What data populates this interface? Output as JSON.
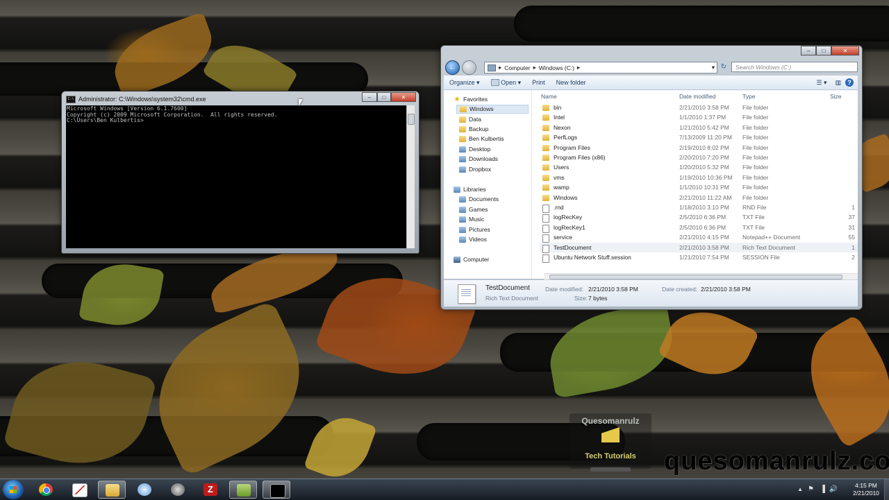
{
  "cmd": {
    "title": "Administrator: C:\\Windows\\system32\\cmd.exe",
    "icon_text": "C:\\",
    "lines": [
      "Microsoft Windows [Version 6.1.7600]",
      "Copyright (c) 2009 Microsoft Corporation.  All rights reserved.",
      "",
      "C:\\Users\\Ben Kulbertis>"
    ]
  },
  "explorer": {
    "breadcrumb": [
      "Computer",
      "Windows (C:)"
    ],
    "search_placeholder": "Search Windows (C:)",
    "toolbar": [
      "Organize",
      "Open",
      "Print",
      "New folder"
    ],
    "nav": {
      "favorites_label": "Favorites",
      "favorites": [
        "Windows",
        "Data",
        "Backup",
        "Ben Kulbertis",
        "Desktop",
        "Downloads",
        "Dropbox"
      ],
      "libraries_label": "Libraries",
      "libraries": [
        "Documents",
        "Games",
        "Music",
        "Pictures",
        "Videos"
      ],
      "computer_label": "Computer"
    },
    "columns": [
      "Name",
      "Date modified",
      "Type",
      "Size"
    ],
    "files": [
      {
        "name": "bin",
        "date": "2/21/2010 3:58 PM",
        "type": "File folder",
        "size": "",
        "kind": "folder"
      },
      {
        "name": "Intel",
        "date": "1/1/2010 1:37 PM",
        "type": "File folder",
        "size": "",
        "kind": "folder"
      },
      {
        "name": "Nexon",
        "date": "1/21/2010 5:42 PM",
        "type": "File folder",
        "size": "",
        "kind": "folder"
      },
      {
        "name": "PerfLogs",
        "date": "7/13/2009 11:20 PM",
        "type": "File folder",
        "size": "",
        "kind": "folder"
      },
      {
        "name": "Program Files",
        "date": "2/19/2010 8:02 PM",
        "type": "File folder",
        "size": "",
        "kind": "folder"
      },
      {
        "name": "Program Files (x86)",
        "date": "2/20/2010 7:20 PM",
        "type": "File folder",
        "size": "",
        "kind": "folder"
      },
      {
        "name": "Users",
        "date": "1/20/2010 5:32 PM",
        "type": "File folder",
        "size": "",
        "kind": "folder"
      },
      {
        "name": "vms",
        "date": "1/19/2010 10:36 PM",
        "type": "File folder",
        "size": "",
        "kind": "folder"
      },
      {
        "name": "wamp",
        "date": "1/1/2010 10:31 PM",
        "type": "File folder",
        "size": "",
        "kind": "folder"
      },
      {
        "name": "Windows",
        "date": "2/21/2010 11:22 AM",
        "type": "File folder",
        "size": "",
        "kind": "folder"
      },
      {
        "name": ".rnd",
        "date": "1/18/2010 3:10 PM",
        "type": "RND File",
        "size": "1",
        "kind": "file"
      },
      {
        "name": "logRecKey",
        "date": "2/5/2010 6:36 PM",
        "type": "TXT File",
        "size": "37",
        "kind": "file"
      },
      {
        "name": "logRecKey1",
        "date": "2/5/2010 6:36 PM",
        "type": "TXT File",
        "size": "31",
        "kind": "file"
      },
      {
        "name": "service",
        "date": "2/21/2010 4:15 PM",
        "type": "Notepad++ Document",
        "size": "55",
        "kind": "file"
      },
      {
        "name": "TestDocument",
        "date": "2/21/2010 3:58 PM",
        "type": "Rich Text Document",
        "size": "1",
        "kind": "file",
        "selected": true
      },
      {
        "name": "Ubuntu Network Stuff.session",
        "date": "1/21/2010 7:54 PM",
        "type": "SESSION File",
        "size": "2",
        "kind": "file"
      }
    ],
    "details": {
      "name": "TestDocument",
      "type": "Rich Text Document",
      "date_modified_label": "Date modified:",
      "date_modified": "2/21/2010 3:58 PM",
      "date_created_label": "Date created:",
      "date_created": "2/21/2010 3:58 PM",
      "size_label": "Size:",
      "size": "7 bytes"
    }
  },
  "watermark": {
    "title": "Quesomanrulz",
    "subtitle": "Tech Tutorials",
    "site": "quesomanrulz.com"
  },
  "taskbar": {
    "icons": [
      "start-orb",
      "chrome",
      "gmail",
      "windows-explorer",
      "itunes",
      "steam",
      "filezilla",
      "notepad",
      "cmd"
    ],
    "clock_time": "4:15 PM",
    "clock_date": "2/21/2010"
  }
}
